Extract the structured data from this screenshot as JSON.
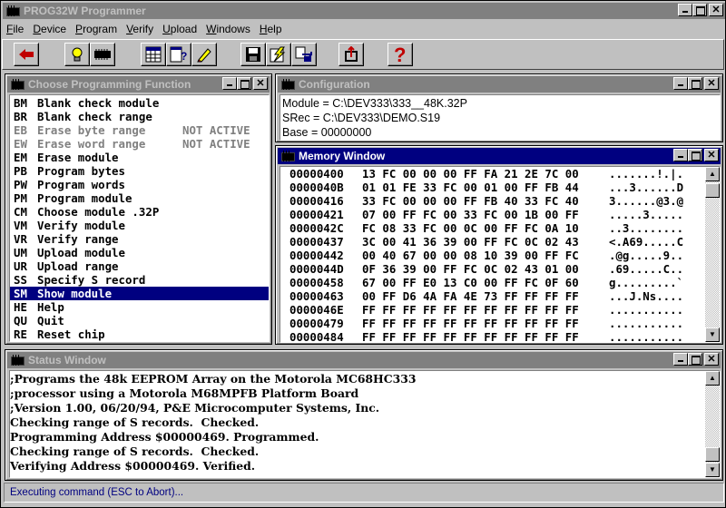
{
  "app": {
    "title": "PROG32W Programmer"
  },
  "menu": [
    {
      "label": "File",
      "u": "F",
      "rest": "ile"
    },
    {
      "label": "Device",
      "u": "D",
      "rest": "evice"
    },
    {
      "label": "Program",
      "u": "P",
      "rest": "rogram"
    },
    {
      "label": "Verify",
      "u": "V",
      "rest": "erify"
    },
    {
      "label": "Upload",
      "u": "U",
      "rest": "pload"
    },
    {
      "label": "Windows",
      "u": "W",
      "rest": "indows"
    },
    {
      "label": "Help",
      "u": "H",
      "rest": "elp"
    }
  ],
  "toolbar": {
    "icons": [
      "back-arrow-icon",
      "lightbulb-icon",
      "chip-icon",
      "grid-icon",
      "help-cursor-icon",
      "pencil-icon",
      "save-disk-icon",
      "lightning-icon",
      "transfer-icon",
      "export-icon",
      "question-mark-icon"
    ]
  },
  "choose": {
    "title": "Choose Programming Function",
    "items": [
      {
        "code": "BM",
        "text": "Blank check module",
        "status": "",
        "state": "normal"
      },
      {
        "code": "BR",
        "text": "Blank check range",
        "status": "",
        "state": "normal"
      },
      {
        "code": "EB",
        "text": "Erase byte range",
        "status": "NOT ACTIVE",
        "state": "disabled"
      },
      {
        "code": "EW",
        "text": "Erase word range",
        "status": "NOT ACTIVE",
        "state": "disabled"
      },
      {
        "code": "EM",
        "text": "Erase module",
        "status": "",
        "state": "normal"
      },
      {
        "code": "PB",
        "text": "Program bytes",
        "status": "",
        "state": "normal"
      },
      {
        "code": "PW",
        "text": "Program words",
        "status": "",
        "state": "normal"
      },
      {
        "code": "PM",
        "text": "Program module",
        "status": "",
        "state": "normal"
      },
      {
        "code": "CM",
        "text": "Choose module .32P",
        "status": "",
        "state": "normal"
      },
      {
        "code": "VM",
        "text": "Verify module",
        "status": "",
        "state": "normal"
      },
      {
        "code": "VR",
        "text": "Verify range",
        "status": "",
        "state": "normal"
      },
      {
        "code": "UM",
        "text": "Upload module",
        "status": "",
        "state": "normal"
      },
      {
        "code": "UR",
        "text": "Upload range",
        "status": "",
        "state": "normal"
      },
      {
        "code": "SS",
        "text": "Specify S record",
        "status": "",
        "state": "normal"
      },
      {
        "code": "SM",
        "text": "Show module",
        "status": "",
        "state": "selected"
      },
      {
        "code": "HE",
        "text": "Help",
        "status": "",
        "state": "normal"
      },
      {
        "code": "QU",
        "text": "Quit",
        "status": "",
        "state": "normal"
      },
      {
        "code": "RE",
        "text": "Reset chip",
        "status": "",
        "state": "normal"
      }
    ]
  },
  "config": {
    "title": "Configuration",
    "lines": [
      "Module = C:\\DEV333\\333__48K.32P",
      "SRec = C:\\DEV333\\DEMO.S19",
      "Base = 00000000"
    ]
  },
  "memory": {
    "title": "Memory Window",
    "rows": [
      {
        "addr": "00000400",
        "bytes": "13 FC 00 00 00 FF FA 21 2E 7C 00",
        "ascii": ".......!.|."
      },
      {
        "addr": "0000040B",
        "bytes": "01 01 FE 33 FC 00 01 00 FF FB 44",
        "ascii": "...3......D"
      },
      {
        "addr": "00000416",
        "bytes": "33 FC 00 00 00 FF FB 40 33 FC 40",
        "ascii": "3......@3.@"
      },
      {
        "addr": "00000421",
        "bytes": "07 00 FF FC 00 33 FC 00 1B 00 FF",
        "ascii": ".....3....."
      },
      {
        "addr": "0000042C",
        "bytes": "FC 08 33 FC 00 0C 00 FF FC 0A 10",
        "ascii": "..3........"
      },
      {
        "addr": "00000437",
        "bytes": "3C 00 41 36 39 00 FF FC 0C 02 43",
        "ascii": "<.A69.....C"
      },
      {
        "addr": "00000442",
        "bytes": "00 40 67 00 00 08 10 39 00 FF FC",
        "ascii": ".@g.....9.."
      },
      {
        "addr": "0000044D",
        "bytes": "0F 36 39 00 FF FC 0C 02 43 01 00",
        "ascii": ".69.....C.."
      },
      {
        "addr": "00000458",
        "bytes": "67 00 FF E0 13 C0 00 FF FC 0F 60",
        "ascii": "g.........`"
      },
      {
        "addr": "00000463",
        "bytes": "00 FF D6 4A FA 4E 73 FF FF FF FF",
        "ascii": "...J.Ns...."
      },
      {
        "addr": "0000046E",
        "bytes": "FF FF FF FF FF FF FF FF FF FF FF",
        "ascii": "..........."
      },
      {
        "addr": "00000479",
        "bytes": "FF FF FF FF FF FF FF FF FF FF FF",
        "ascii": "..........."
      },
      {
        "addr": "00000484",
        "bytes": "FF FF FF FF FF FF FF FF FF FF FF",
        "ascii": "..........."
      }
    ]
  },
  "status": {
    "title": "Status Window",
    "lines": [
      ";Programs the 48k EEPROM Array on the Motorola MC68HC333",
      ";processor using a Motorola M68MPFB Platform Board",
      ";Version 1.00, 06/20/94, P&E Microcomputer Systems, Inc.",
      "Checking range of S records.  Checked.",
      "Programming Address $00000469. Programmed.",
      "Checking range of S records.  Checked.",
      "Verifying Address $00000469. Verified."
    ]
  },
  "statusbar": {
    "text": "Executing command (ESC to Abort)..."
  },
  "colors": {
    "active_title": "#000080",
    "inactive_title": "#808080",
    "selection": "#000080",
    "toolbar_red": "#c00000"
  }
}
